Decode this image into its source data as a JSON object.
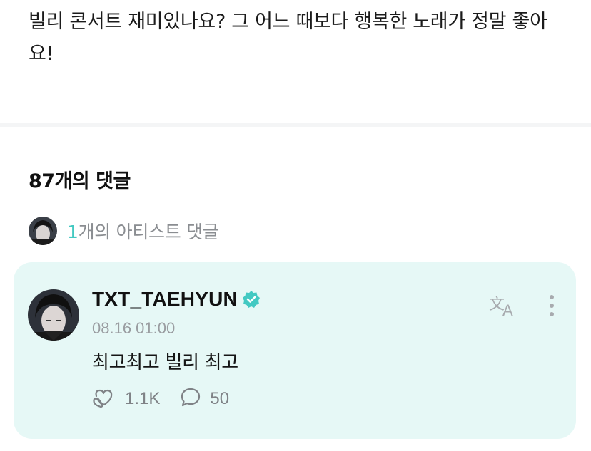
{
  "post": {
    "body": "빌리 콘서트 재미있나요? 그 어느 때보다 행복한 노래가 정말 좋아요!"
  },
  "comments_section": {
    "header": "87개의 댓글",
    "artist_comments": {
      "count": "1",
      "label": "개의 아티스트 댓글"
    }
  },
  "comment": {
    "author": "TXT_TAEHYUN",
    "timestamp": "08.16 01:00",
    "text": "최고최고 빌리 최고",
    "likes": "1.1K",
    "replies": "50"
  },
  "icons": {
    "verified": "verified-badge-icon",
    "translate": "translate-icon",
    "more": "more-vertical-icon",
    "like": "heart-hand-icon",
    "reply": "speech-bubble-icon"
  },
  "colors": {
    "accent": "#43c9c2",
    "card_background": "#e6f8f6",
    "muted_text": "#8a8d91"
  }
}
